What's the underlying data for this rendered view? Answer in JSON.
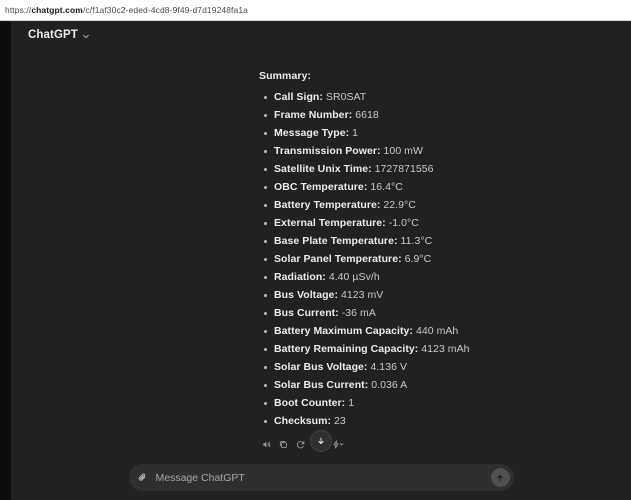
{
  "browser": {
    "url_prefix": "https://",
    "url_host": "chatgpt.com",
    "url_path": "/c/f1af30c2-eded-4cd8-9f49-d7d19248fa1a",
    "url_full": "https://chatgpt.com/c/f1af30c2-eded-4cd8-9f49-d7d19248fa1a"
  },
  "header": {
    "model_name": "ChatGPT",
    "chevron_icon": "chevron-down-icon"
  },
  "message": {
    "summary_heading": "Summary:",
    "facts": [
      {
        "label": "Call Sign:",
        "value": "SR0SAT"
      },
      {
        "label": "Frame Number:",
        "value": "6618"
      },
      {
        "label": "Message Type:",
        "value": "1"
      },
      {
        "label": "Transmission Power:",
        "value": "100 mW"
      },
      {
        "label": "Satellite Unix Time:",
        "value": "1727871556"
      },
      {
        "label": "OBC Temperature:",
        "value": "16.4°C"
      },
      {
        "label": "Battery Temperature:",
        "value": "22.9°C"
      },
      {
        "label": "External Temperature:",
        "value": "-1.0°C"
      },
      {
        "label": "Base Plate Temperature:",
        "value": "11.3°C"
      },
      {
        "label": "Solar Panel Temperature:",
        "value": "6.9°C"
      },
      {
        "label": "Radiation:",
        "value": "4.40 µSv/h"
      },
      {
        "label": "Bus Voltage:",
        "value": "4123 mV"
      },
      {
        "label": "Bus Current:",
        "value": "-36 mA"
      },
      {
        "label": "Battery Maximum Capacity:",
        "value": "440 mAh"
      },
      {
        "label": "Battery Remaining Capacity:",
        "value": "4123 mAh"
      },
      {
        "label": "Solar Bus Voltage:",
        "value": "4.136 V"
      },
      {
        "label": "Solar Bus Current:",
        "value": "0.036 A"
      },
      {
        "label": "Boot Counter:",
        "value": "1"
      },
      {
        "label": "Checksum:",
        "value": "23"
      }
    ],
    "actions": [
      {
        "name": "read-aloud-icon"
      },
      {
        "name": "copy-icon"
      },
      {
        "name": "regenerate-icon"
      },
      {
        "name": "thumbs-down-icon"
      },
      {
        "name": "switch-model-icon"
      }
    ]
  },
  "scroll_button": {
    "icon": "arrow-down-icon"
  },
  "composer": {
    "attach_icon": "paperclip-icon",
    "placeholder": "Message ChatGPT",
    "value": "",
    "send_icon": "arrow-up-icon"
  },
  "colors": {
    "app_bg": "#212121",
    "rail_bg": "#0d0d0d",
    "composer_bg": "#2f2f2f",
    "text_primary": "#ececec",
    "text_secondary": "#c9c9c9",
    "urlbar_bg": "#ffffff"
  }
}
